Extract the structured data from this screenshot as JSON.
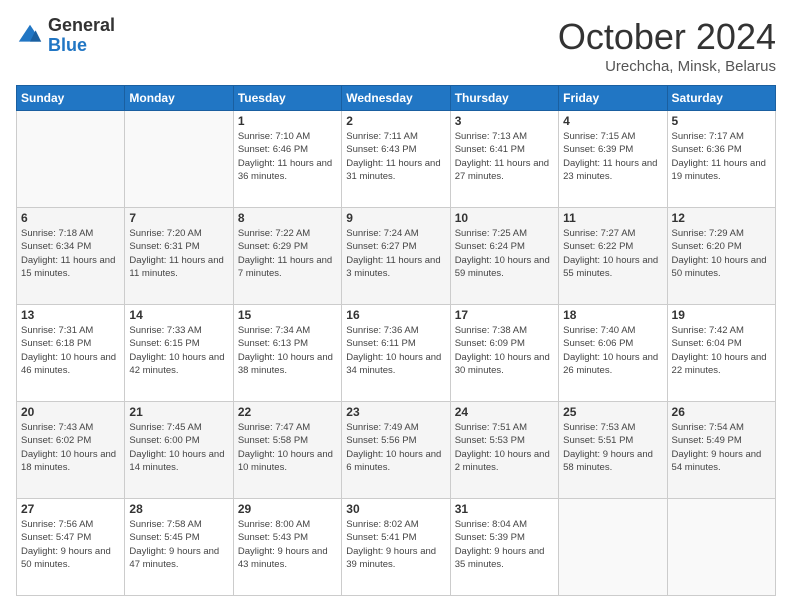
{
  "logo": {
    "general": "General",
    "blue": "Blue"
  },
  "header": {
    "month": "October 2024",
    "location": "Urechcha, Minsk, Belarus"
  },
  "weekdays": [
    "Sunday",
    "Monday",
    "Tuesday",
    "Wednesday",
    "Thursday",
    "Friday",
    "Saturday"
  ],
  "weeks": [
    [
      {
        "day": "",
        "info": ""
      },
      {
        "day": "",
        "info": ""
      },
      {
        "day": "1",
        "info": "Sunrise: 7:10 AM\nSunset: 6:46 PM\nDaylight: 11 hours and 36 minutes."
      },
      {
        "day": "2",
        "info": "Sunrise: 7:11 AM\nSunset: 6:43 PM\nDaylight: 11 hours and 31 minutes."
      },
      {
        "day": "3",
        "info": "Sunrise: 7:13 AM\nSunset: 6:41 PM\nDaylight: 11 hours and 27 minutes."
      },
      {
        "day": "4",
        "info": "Sunrise: 7:15 AM\nSunset: 6:39 PM\nDaylight: 11 hours and 23 minutes."
      },
      {
        "day": "5",
        "info": "Sunrise: 7:17 AM\nSunset: 6:36 PM\nDaylight: 11 hours and 19 minutes."
      }
    ],
    [
      {
        "day": "6",
        "info": "Sunrise: 7:18 AM\nSunset: 6:34 PM\nDaylight: 11 hours and 15 minutes."
      },
      {
        "day": "7",
        "info": "Sunrise: 7:20 AM\nSunset: 6:31 PM\nDaylight: 11 hours and 11 minutes."
      },
      {
        "day": "8",
        "info": "Sunrise: 7:22 AM\nSunset: 6:29 PM\nDaylight: 11 hours and 7 minutes."
      },
      {
        "day": "9",
        "info": "Sunrise: 7:24 AM\nSunset: 6:27 PM\nDaylight: 11 hours and 3 minutes."
      },
      {
        "day": "10",
        "info": "Sunrise: 7:25 AM\nSunset: 6:24 PM\nDaylight: 10 hours and 59 minutes."
      },
      {
        "day": "11",
        "info": "Sunrise: 7:27 AM\nSunset: 6:22 PM\nDaylight: 10 hours and 55 minutes."
      },
      {
        "day": "12",
        "info": "Sunrise: 7:29 AM\nSunset: 6:20 PM\nDaylight: 10 hours and 50 minutes."
      }
    ],
    [
      {
        "day": "13",
        "info": "Sunrise: 7:31 AM\nSunset: 6:18 PM\nDaylight: 10 hours and 46 minutes."
      },
      {
        "day": "14",
        "info": "Sunrise: 7:33 AM\nSunset: 6:15 PM\nDaylight: 10 hours and 42 minutes."
      },
      {
        "day": "15",
        "info": "Sunrise: 7:34 AM\nSunset: 6:13 PM\nDaylight: 10 hours and 38 minutes."
      },
      {
        "day": "16",
        "info": "Sunrise: 7:36 AM\nSunset: 6:11 PM\nDaylight: 10 hours and 34 minutes."
      },
      {
        "day": "17",
        "info": "Sunrise: 7:38 AM\nSunset: 6:09 PM\nDaylight: 10 hours and 30 minutes."
      },
      {
        "day": "18",
        "info": "Sunrise: 7:40 AM\nSunset: 6:06 PM\nDaylight: 10 hours and 26 minutes."
      },
      {
        "day": "19",
        "info": "Sunrise: 7:42 AM\nSunset: 6:04 PM\nDaylight: 10 hours and 22 minutes."
      }
    ],
    [
      {
        "day": "20",
        "info": "Sunrise: 7:43 AM\nSunset: 6:02 PM\nDaylight: 10 hours and 18 minutes."
      },
      {
        "day": "21",
        "info": "Sunrise: 7:45 AM\nSunset: 6:00 PM\nDaylight: 10 hours and 14 minutes."
      },
      {
        "day": "22",
        "info": "Sunrise: 7:47 AM\nSunset: 5:58 PM\nDaylight: 10 hours and 10 minutes."
      },
      {
        "day": "23",
        "info": "Sunrise: 7:49 AM\nSunset: 5:56 PM\nDaylight: 10 hours and 6 minutes."
      },
      {
        "day": "24",
        "info": "Sunrise: 7:51 AM\nSunset: 5:53 PM\nDaylight: 10 hours and 2 minutes."
      },
      {
        "day": "25",
        "info": "Sunrise: 7:53 AM\nSunset: 5:51 PM\nDaylight: 9 hours and 58 minutes."
      },
      {
        "day": "26",
        "info": "Sunrise: 7:54 AM\nSunset: 5:49 PM\nDaylight: 9 hours and 54 minutes."
      }
    ],
    [
      {
        "day": "27",
        "info": "Sunrise: 7:56 AM\nSunset: 5:47 PM\nDaylight: 9 hours and 50 minutes."
      },
      {
        "day": "28",
        "info": "Sunrise: 7:58 AM\nSunset: 5:45 PM\nDaylight: 9 hours and 47 minutes."
      },
      {
        "day": "29",
        "info": "Sunrise: 8:00 AM\nSunset: 5:43 PM\nDaylight: 9 hours and 43 minutes."
      },
      {
        "day": "30",
        "info": "Sunrise: 8:02 AM\nSunset: 5:41 PM\nDaylight: 9 hours and 39 minutes."
      },
      {
        "day": "31",
        "info": "Sunrise: 8:04 AM\nSunset: 5:39 PM\nDaylight: 9 hours and 35 minutes."
      },
      {
        "day": "",
        "info": ""
      },
      {
        "day": "",
        "info": ""
      }
    ]
  ]
}
